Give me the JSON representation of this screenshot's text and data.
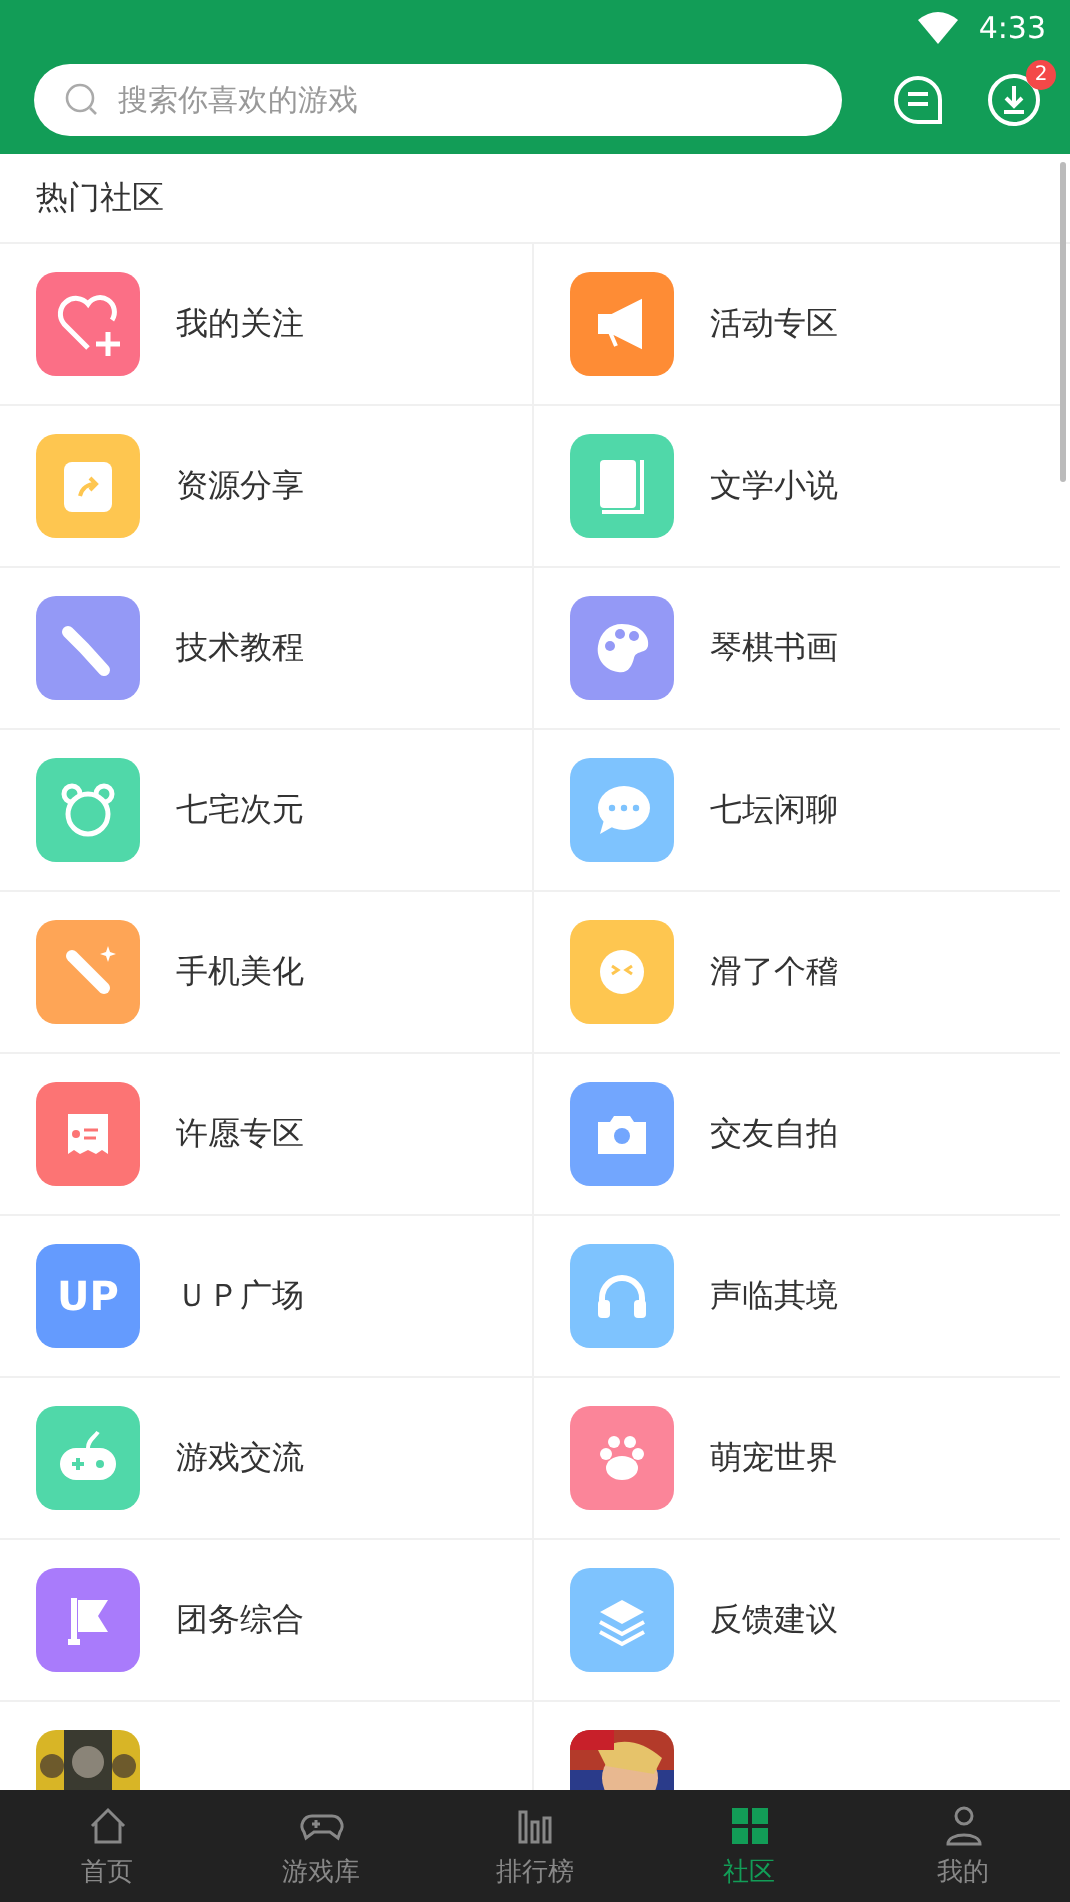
{
  "status_bar": {
    "time": "4:33"
  },
  "header": {
    "search": {
      "placeholder": "搜索你喜欢的游戏"
    },
    "download_badge": "2"
  },
  "section_title": "热门社区",
  "communities": [
    {
      "name": "我的关注",
      "kind": "icon",
      "color": "#fb6f86"
    },
    {
      "name": "活动专区",
      "kind": "icon",
      "color": "#fe8c35"
    },
    {
      "name": "资源分享",
      "kind": "icon",
      "color": "#fec650"
    },
    {
      "name": "文学小说",
      "kind": "icon",
      "color": "#50d8a9"
    },
    {
      "name": "技术教程",
      "kind": "icon",
      "color": "#9499f6"
    },
    {
      "name": "琴棋书画",
      "kind": "icon",
      "color": "#9499f6"
    },
    {
      "name": "七宅次元",
      "kind": "icon",
      "color": "#50d8a9"
    },
    {
      "name": "七坛闲聊",
      "kind": "icon",
      "color": "#7ec3fe"
    },
    {
      "name": "手机美化",
      "kind": "icon",
      "color": "#fea556"
    },
    {
      "name": "滑了个稽",
      "kind": "icon",
      "color": "#fec650"
    },
    {
      "name": "许愿专区",
      "kind": "icon",
      "color": "#fc7474"
    },
    {
      "name": "交友自拍",
      "kind": "icon",
      "color": "#72a6fe"
    },
    {
      "name": "ＵＰ广场",
      "kind": "icon",
      "color": "#649bfe",
      "icon_text": "UP"
    },
    {
      "name": "声临其境",
      "kind": "icon",
      "color": "#7ec3fe"
    },
    {
      "name": "游戏交流",
      "kind": "icon",
      "color": "#50d8a9"
    },
    {
      "name": "萌宠世界",
      "kind": "icon",
      "color": "#fb8599"
    },
    {
      "name": "团务综合",
      "kind": "icon",
      "color": "#a97bfb"
    },
    {
      "name": "反馈建议",
      "kind": "icon",
      "color": "#7ec3fe"
    },
    {
      "kind": "picture"
    },
    {
      "kind": "picture"
    }
  ],
  "tab_bar": [
    {
      "label": "首页",
      "selected": false
    },
    {
      "label": "游戏库",
      "selected": false
    },
    {
      "label": "排行榜",
      "selected": false
    },
    {
      "label": "社区",
      "selected": true
    },
    {
      "label": "我的",
      "selected": false
    }
  ]
}
